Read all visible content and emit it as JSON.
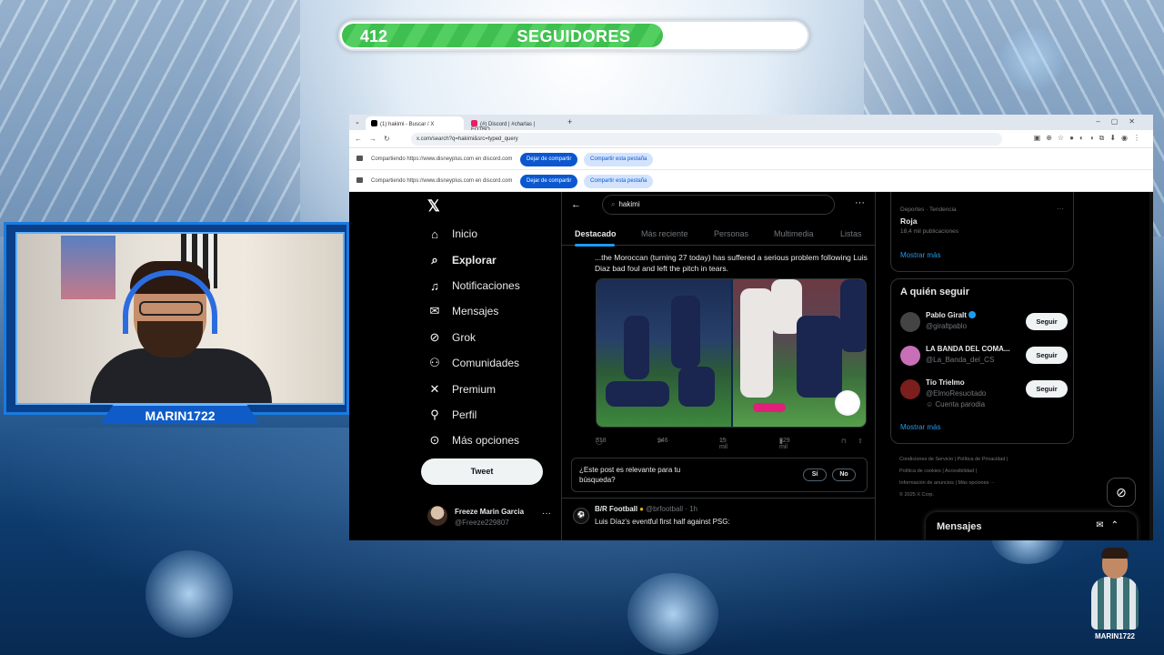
{
  "overlay": {
    "followers": {
      "current": "412",
      "label": "SEGUIDORES",
      "goal": "600",
      "progress_fraction": 0.687
    },
    "webcam_name": "MARIN1722",
    "avatar_name": "MARIN1722"
  },
  "browser": {
    "tabs": [
      {
        "label": "(1) hakimi - Buscar / X",
        "active": true,
        "icon_color": "#000000"
      },
      {
        "label": "(#) Discord | #charlas | FOTBO...",
        "active": false,
        "icon_color": "#e91e63"
      }
    ],
    "url": "x.com/search?q=hakimi&src=typed_query",
    "share_bars": [
      {
        "text": "Compartiendo https://www.disneyplus.com en discord.com",
        "stop_label": "Dejar de compartir",
        "tab_label": "Compartir esta pestaña"
      },
      {
        "text": "Compartiendo https://www.disneyplus.com en discord.com",
        "stop_label": "Dejar de compartir",
        "tab_label": "Compartir esta pestaña"
      }
    ]
  },
  "x": {
    "nav": [
      {
        "label": "Inicio",
        "icon": "home-icon"
      },
      {
        "label": "Explorar",
        "icon": "search-icon",
        "active": true
      },
      {
        "label": "Notificaciones",
        "icon": "bell-icon"
      },
      {
        "label": "Mensajes",
        "icon": "mail-icon"
      },
      {
        "label": "Grok",
        "icon": "grok-icon"
      },
      {
        "label": "Comunidades",
        "icon": "people-icon"
      },
      {
        "label": "Premium",
        "icon": "x-icon"
      },
      {
        "label": "Perfil",
        "icon": "person-icon"
      },
      {
        "label": "Más opciones",
        "icon": "more-circle-icon"
      }
    ],
    "tweet_button": "Tweet",
    "account": {
      "name": "Freeze Marin Garcia",
      "handle": "@Freeze229807"
    },
    "search_value": "hakimi",
    "tabs": [
      "Destacado",
      "Más reciente",
      "Personas",
      "Multimedia",
      "Listas"
    ],
    "post": {
      "text": "...the Moroccan (turning 27 today) has suffered a serious problem following Luis Diaz bad foul and left the pitch in tears.",
      "replies": "518",
      "reposts": "946",
      "likes": "15 mil",
      "views": "929 mil"
    },
    "relevance": {
      "question": "¿Este post es relevante para tu búsqueda?",
      "yes": "Sí",
      "no": "No"
    },
    "post2": {
      "name": "B/R Football",
      "handle": "@brfootball",
      "time": "· 1h",
      "text": "Luis Díaz's eventful first half against PSG:"
    },
    "trend": {
      "category": "Deportes · Tendencia",
      "name": "Roja",
      "count": "18,4 mil publicaciones",
      "more": "Mostrar más"
    },
    "who_to_follow": {
      "title": "A quién seguir",
      "follow_label": "Seguir",
      "users": [
        {
          "name": "Pablo Giralt",
          "handle": "@giraltpablo",
          "verified": true,
          "extra": "",
          "color": "#444444"
        },
        {
          "name": "LA BANDA DEL COMA...",
          "handle": "@La_Banda_del_CS",
          "verified": false,
          "extra": "",
          "color": "#c86fb8"
        },
        {
          "name": "Tío Trielmo",
          "handle": "@ElmoResucitado",
          "verified": false,
          "extra": "Cuenta parodia",
          "color": "#7a1e1e"
        }
      ],
      "more": "Mostrar más"
    },
    "footer": [
      "Condiciones de Servicio",
      "Política de Privacidad",
      "Política de cookies",
      "Accesibilidad",
      "Información de anuncios",
      "Más opciones ···",
      "© 2025 X Corp."
    ],
    "messages_label": "Mensajes"
  }
}
